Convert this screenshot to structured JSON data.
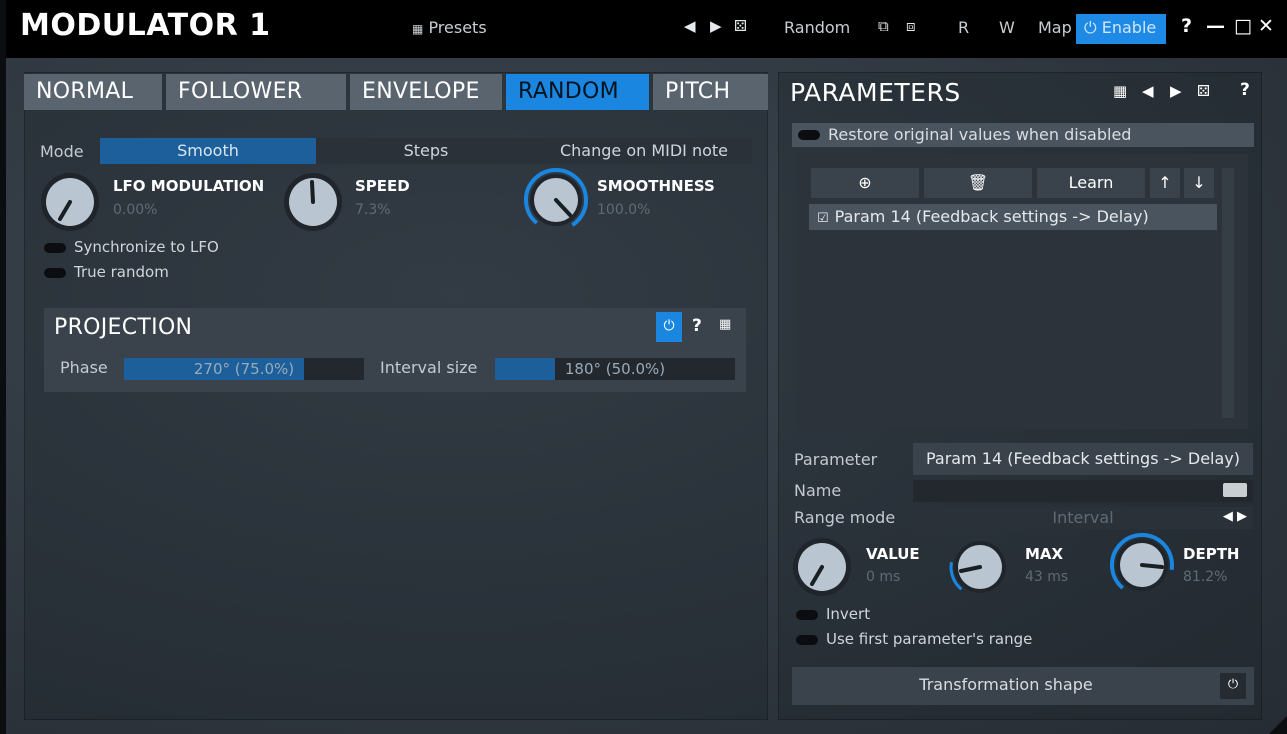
{
  "window": {
    "title": "MODULATOR 1",
    "presets_label": "Presets",
    "random_label": "Random",
    "r_label": "R",
    "w_label": "W",
    "map_label": "Map",
    "enable_label": "Enable",
    "help_label": "?",
    "accent_color": "#1b86e0"
  },
  "tabs": [
    {
      "label": "NORMAL"
    },
    {
      "label": "FOLLOWER"
    },
    {
      "label": "ENVELOPE"
    },
    {
      "label": "RANDOM",
      "active": true
    },
    {
      "label": "PITCH"
    }
  ],
  "random_panel": {
    "mode_label": "Mode",
    "mode_options": [
      "Smooth",
      "Steps",
      "Change on MIDI note"
    ],
    "mode_selected": "Smooth",
    "knobs": [
      {
        "title": "LFO MODULATION",
        "value": "0.00%"
      },
      {
        "title": "SPEED",
        "value": "7.3%"
      },
      {
        "title": "SMOOTHNESS",
        "value": "100.0%"
      }
    ],
    "toggles": [
      {
        "label": "Synchronize to LFO",
        "on": false
      },
      {
        "label": "True random",
        "on": false
      }
    ]
  },
  "projection": {
    "title": "PROJECTION",
    "help_label": "?",
    "phase_label": "Phase",
    "phase_value": "270° (75.0%)",
    "phase_fraction": 0.75,
    "interval_label": "Interval size",
    "interval_value": "180° (50.0%)",
    "interval_fraction": 0.25
  },
  "parameters": {
    "title": "PARAMETERS",
    "help_label": "?",
    "restore_label": "Restore original values when disabled",
    "learn_label": "Learn",
    "list_items": [
      {
        "label": "Param 14 (Feedback settings -> Delay)",
        "checked": true
      }
    ],
    "parameter_label": "Parameter",
    "parameter_value": "Param 14 (Feedback settings -> Delay)",
    "name_label": "Name",
    "name_value": "",
    "range_mode_label": "Range mode",
    "range_mode_value": "Interval",
    "knobs": [
      {
        "title": "VALUE",
        "value": "0 ms"
      },
      {
        "title": "MAX",
        "value": "43 ms"
      },
      {
        "title": "DEPTH",
        "value": "81.2%"
      }
    ],
    "toggles": [
      {
        "label": "Invert",
        "on": false
      },
      {
        "label": "Use first parameter's range",
        "on": false
      }
    ],
    "transformation_label": "Transformation shape"
  }
}
